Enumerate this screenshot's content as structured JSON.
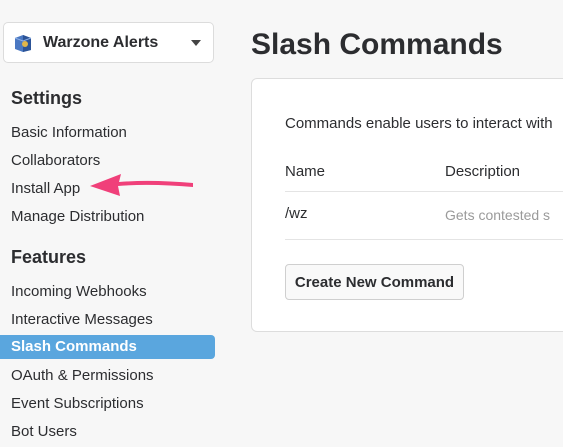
{
  "app_switcher": {
    "app_name": "Warzone Alerts",
    "icon": "app-logo-icon"
  },
  "sidebar": {
    "settings_title": "Settings",
    "settings_items": [
      {
        "label": "Basic Information"
      },
      {
        "label": "Collaborators"
      },
      {
        "label": "Install App"
      },
      {
        "label": "Manage Distribution"
      }
    ],
    "features_title": "Features",
    "features_items": [
      {
        "label": "Incoming Webhooks"
      },
      {
        "label": "Interactive Messages"
      },
      {
        "label": "Slash Commands",
        "active": true
      },
      {
        "label": "OAuth & Permissions"
      },
      {
        "label": "Event Subscriptions"
      },
      {
        "label": "Bot Users"
      }
    ]
  },
  "main": {
    "title": "Slash Commands",
    "intro": "Commands enable users to interact with",
    "table": {
      "headers": [
        "Name",
        "Description"
      ],
      "rows": [
        {
          "command": "/wz",
          "description": "Gets contested s"
        }
      ]
    },
    "create_button": "Create New Command"
  },
  "colors": {
    "active_nav": "#5aa6de",
    "annotation_arrow": "#f0407a"
  }
}
